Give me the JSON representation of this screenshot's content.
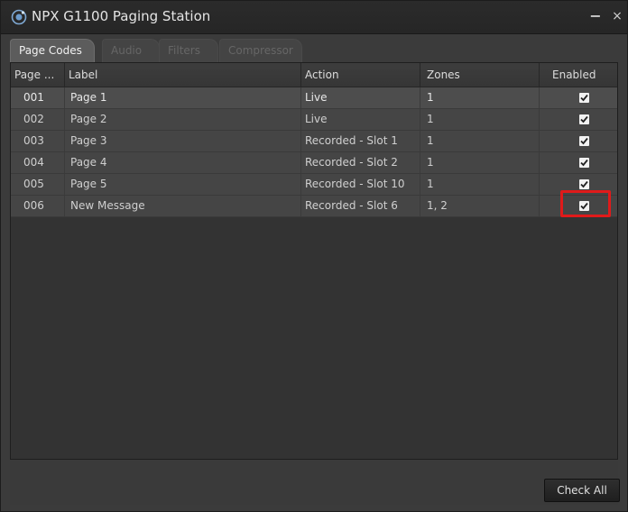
{
  "window": {
    "title": "NPX G1100 Paging Station",
    "minimize_label": "−",
    "close_label": "×"
  },
  "tabs": [
    {
      "label": "Page Codes",
      "active": true
    },
    {
      "label": "Audio",
      "active": false
    },
    {
      "label": "Filters",
      "active": false
    },
    {
      "label": "Compressor",
      "active": false
    }
  ],
  "table": {
    "columns": [
      "Page ...",
      "Label",
      "Action",
      "Zones",
      "Enabled"
    ],
    "rows": [
      {
        "page": "001",
        "label": "Page 1",
        "action": "Live",
        "zones": "1",
        "enabled": true
      },
      {
        "page": "002",
        "label": "Page 2",
        "action": "Live",
        "zones": "1",
        "enabled": true
      },
      {
        "page": "003",
        "label": "Page 3",
        "action": "Recorded - Slot 1",
        "zones": "1",
        "enabled": true
      },
      {
        "page": "004",
        "label": "Page 4",
        "action": "Recorded - Slot 2",
        "zones": "1",
        "enabled": true
      },
      {
        "page": "005",
        "label": "Page 5",
        "action": "Recorded - Slot 10",
        "zones": "1",
        "enabled": true
      },
      {
        "page": "006",
        "label": "New Message",
        "action": "Recorded - Slot 6",
        "zones": "1, 2",
        "enabled": true
      }
    ]
  },
  "footer": {
    "check_all_label": "Check All"
  },
  "colors": {
    "highlight": "#e01a1a"
  }
}
